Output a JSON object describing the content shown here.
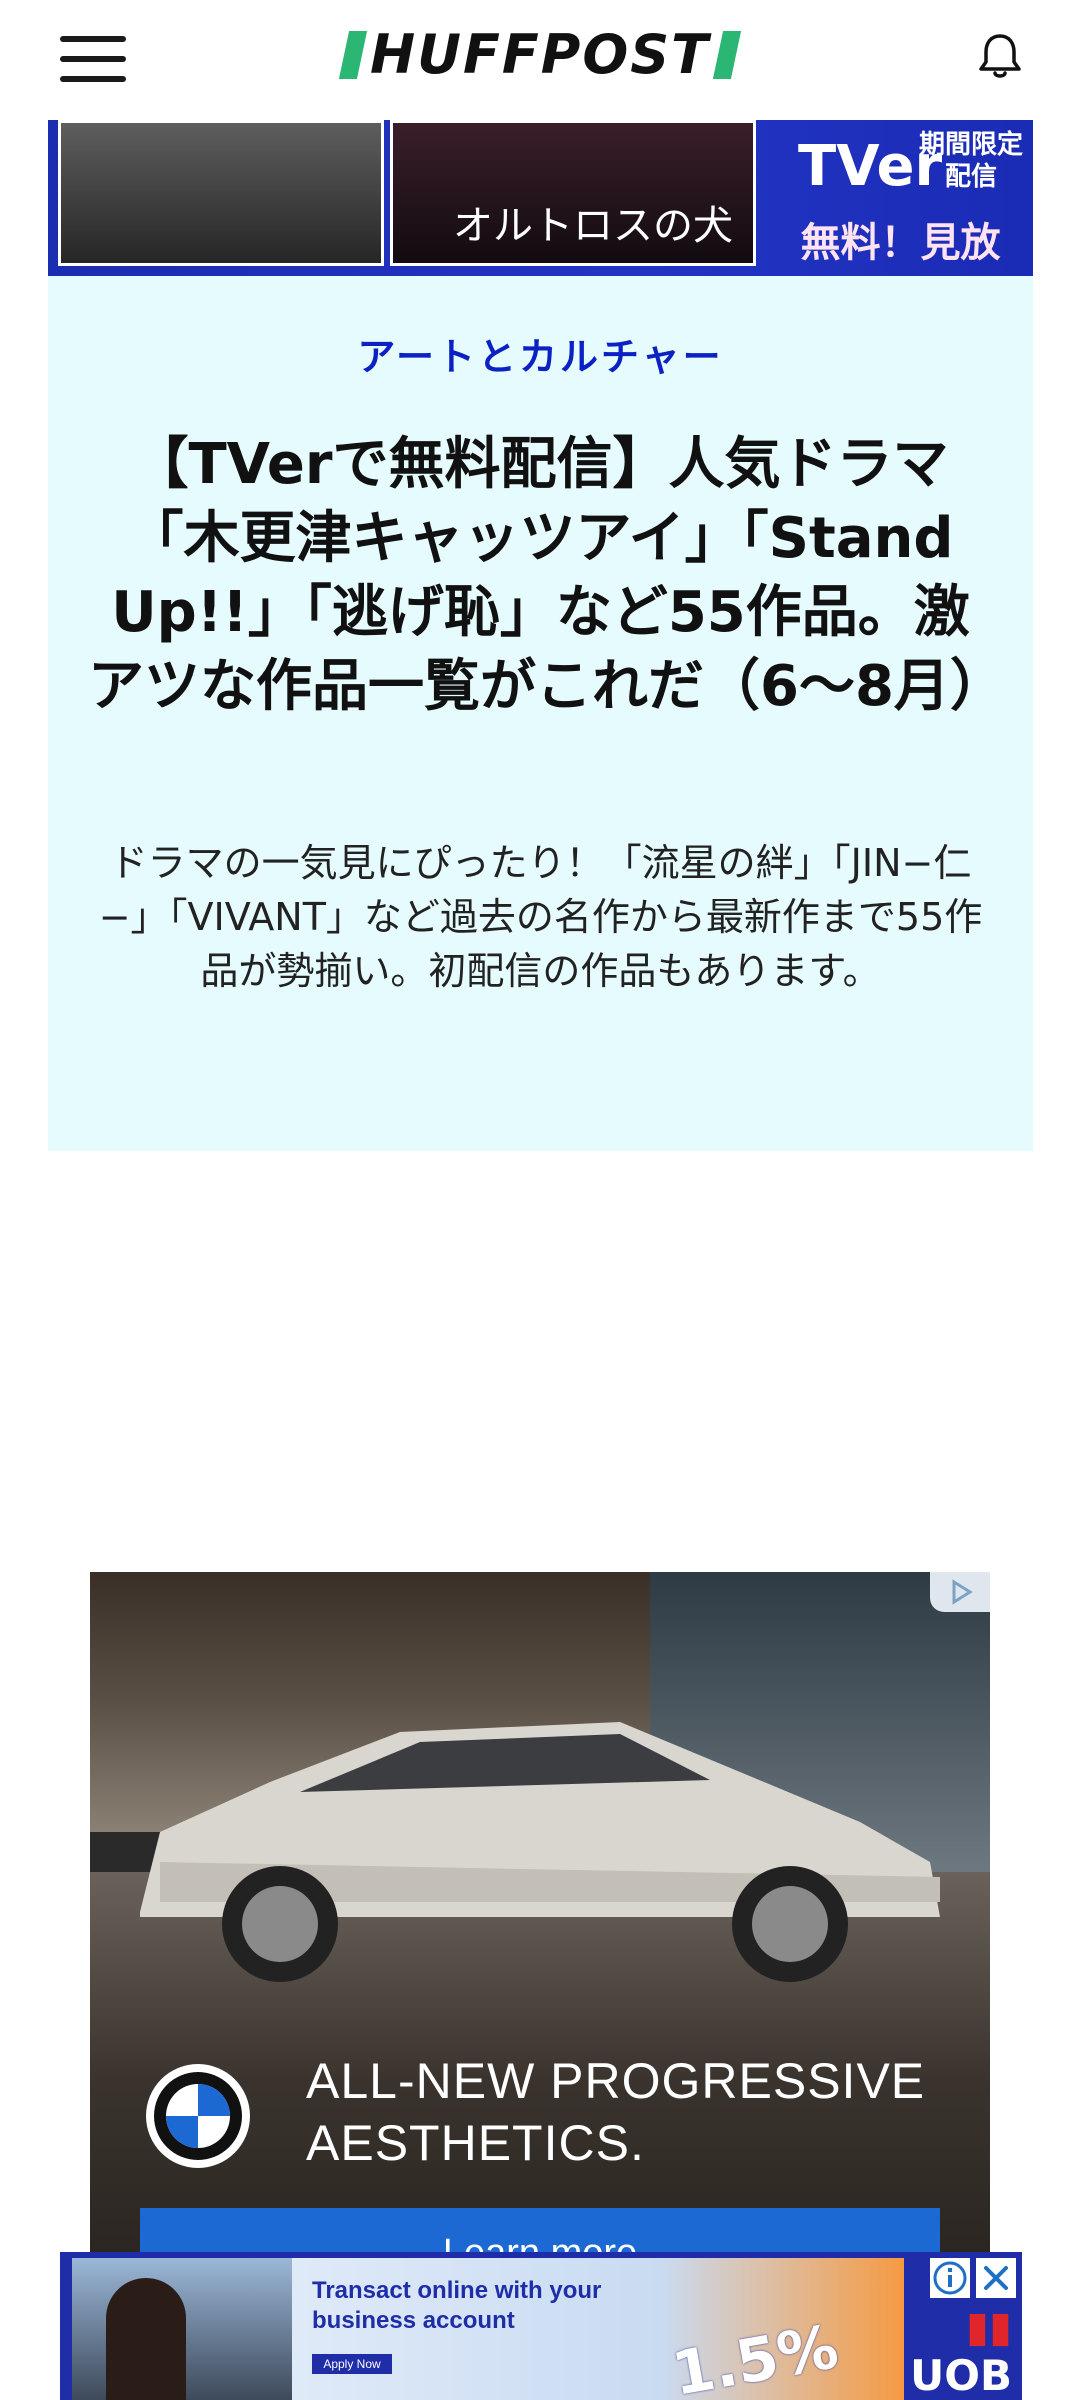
{
  "header": {
    "logo_text": "HUFFPOST",
    "menu_icon": "hamburger-menu-icon",
    "notification_icon": "bell-icon"
  },
  "top_banner": {
    "poster_title": "オルトロスの犬",
    "tver_logo": "TVer",
    "limited_text": "期間限定 配信",
    "free_text": "無料！見放題！"
  },
  "article": {
    "category": "アートとカルチャー",
    "headline": "【TVerで無料配信】人気ドラマ「木更津キャッツアイ」「Stand Up!!」「逃げ恥」など55作品。激アツな作品一覧がこれだ（6〜8月）",
    "dek": "ドラマの一気見にぴったり！「流星の絆」「JIN−仁−」「VIVANT」など過去の名作から最新作まで55作品が勢揃い。初配信の作品もあります。"
  },
  "bmw_ad": {
    "tagline": "ALL-NEW PROGRESSIVE AESTHETICS.",
    "button_label": "Learn more",
    "brand_icon": "bmw-roundel-icon",
    "adchoices_icon": "adchoices-icon"
  },
  "bottom_ad": {
    "headline": "Transact online with your business account",
    "apply_label": "Apply Now",
    "rate": "1.5%",
    "brand": "UOB",
    "info_icon": "info-icon",
    "close_icon": "close-icon"
  },
  "colors": {
    "brand_green": "#2bb673",
    "category_blue": "#0c21c4",
    "card_bg": "#e6fbfd",
    "bmw_blue": "#1c69d4",
    "uob_blue": "#1f2ea8"
  }
}
